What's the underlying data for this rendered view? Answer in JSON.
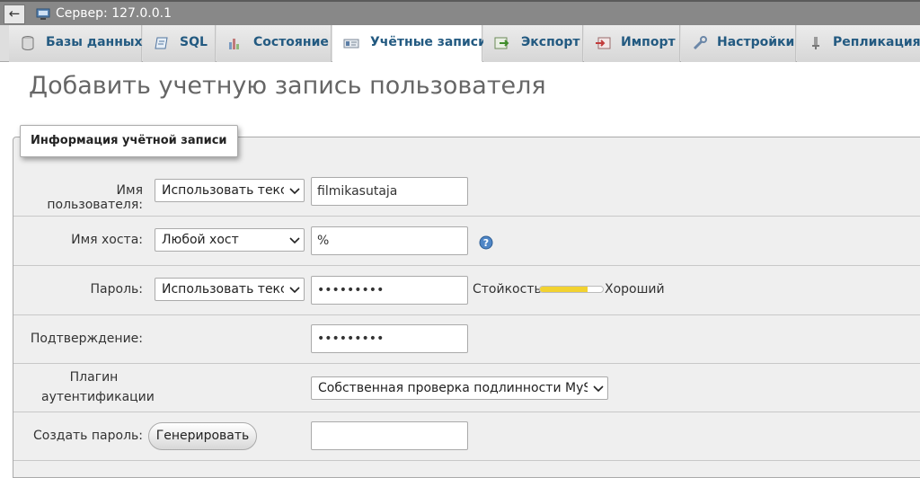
{
  "topbar": {
    "back_glyph": "←",
    "server_label": "Сервер: 127.0.0.1",
    "server_icon": "server-icon"
  },
  "tabs": [
    {
      "label": "Базы данных",
      "icon": "database-icon"
    },
    {
      "label": "SQL",
      "icon": "sql-icon"
    },
    {
      "label": "Состояние",
      "icon": "status-icon"
    },
    {
      "label": "Учётные записи",
      "icon": "users-icon",
      "active": true
    },
    {
      "label": "Экспорт",
      "icon": "export-icon"
    },
    {
      "label": "Импорт",
      "icon": "import-icon"
    },
    {
      "label": "Настройки",
      "icon": "settings-icon"
    },
    {
      "label": "Репликация",
      "icon": "replication-icon"
    }
  ],
  "page_title": "Добавить учетную запись пользователя",
  "fieldset": {
    "legend": "Информация учётной записи"
  },
  "form": {
    "username": {
      "label": "Имя пользователя:",
      "select": "Использовать текстовое поле",
      "value": "filmikasutaja"
    },
    "hostname": {
      "label": "Имя хоста:",
      "select": "Любой хост",
      "value": "%"
    },
    "password": {
      "label": "Пароль:",
      "select": "Использовать текстовое поле",
      "value": "•••••••••"
    },
    "strength": {
      "label": "Стойкость:",
      "value": "Хороший",
      "level": 0.75
    },
    "confirm": {
      "label": "Подтверждение:",
      "value": "•••••••••"
    },
    "auth_plugin": {
      "label_line1": "Плагин",
      "label_line2": "аутентификации",
      "select": "Собственная проверка подлинности MySQL"
    },
    "generate": {
      "label": "Создать пароль:",
      "button": "Генерировать",
      "value": ""
    }
  },
  "colors": {
    "accent": "#235a81",
    "meter": "#f2d230"
  }
}
